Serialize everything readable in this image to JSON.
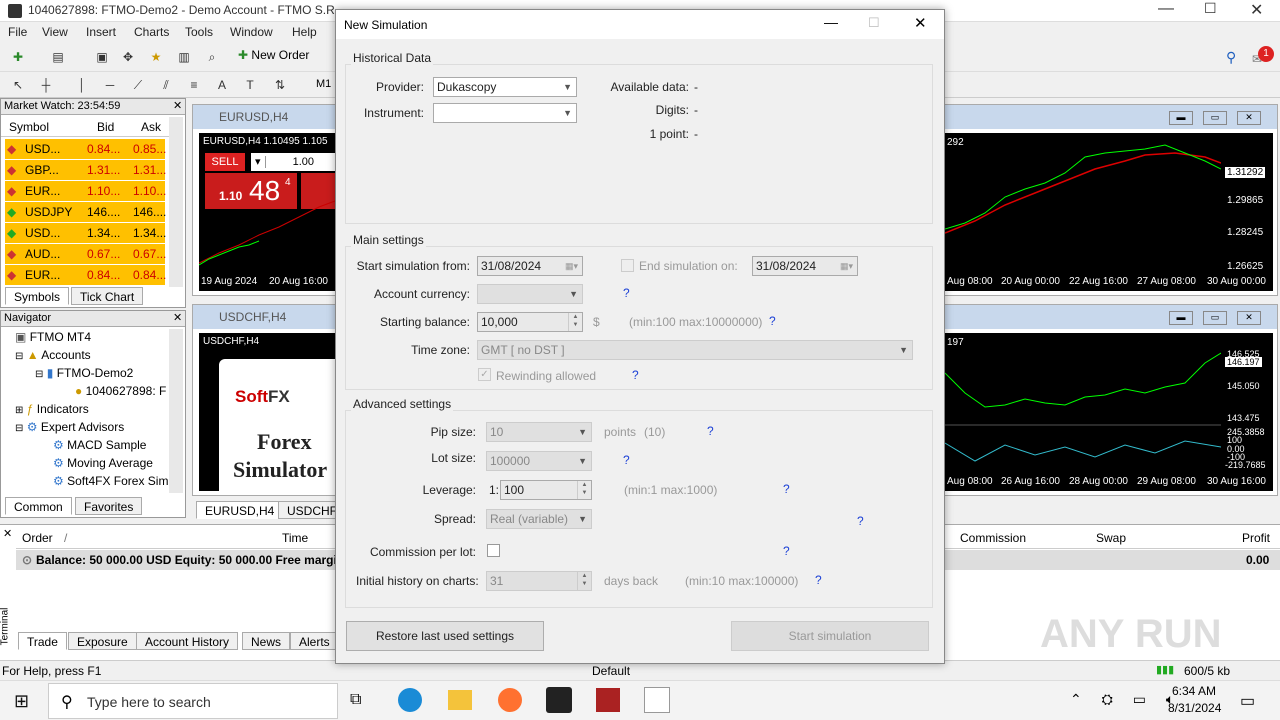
{
  "app": {
    "title": "1040627898: FTMO-Demo2 - Demo Account - FTMO S.R.O.",
    "menu": [
      "File",
      "View",
      "Insert",
      "Charts",
      "Tools",
      "Window",
      "Help"
    ],
    "new_order": "New Order",
    "m1": "M1",
    "notification_count": "1"
  },
  "market_watch": {
    "title": "Market Watch: 23:54:59",
    "headers": [
      "Symbol",
      "Bid",
      "Ask"
    ],
    "rows": [
      {
        "symbol": "USD...",
        "bid": "0.84...",
        "ask": "0.85..."
      },
      {
        "symbol": "GBP...",
        "bid": "1.31...",
        "ask": "1.31..."
      },
      {
        "symbol": "EUR...",
        "bid": "1.10...",
        "ask": "1.10..."
      },
      {
        "symbol": "USDJPY",
        "bid": "146....",
        "ask": "146...."
      },
      {
        "symbol": "USD...",
        "bid": "1.34...",
        "ask": "1.34..."
      },
      {
        "symbol": "AUD...",
        "bid": "0.67...",
        "ask": "0.67..."
      },
      {
        "symbol": "EUR...",
        "bid": "0.84...",
        "ask": "0.84..."
      }
    ],
    "tabs": [
      "Symbols",
      "Tick Chart"
    ]
  },
  "navigator": {
    "title": "Navigator",
    "items": [
      "FTMO MT4",
      "Accounts",
      "FTMO-Demo2",
      "1040627898: F",
      "Indicators",
      "Expert Advisors",
      "MACD Sample",
      "Moving Average",
      "Soft4FX Forex Sim"
    ],
    "tabs": [
      "Common",
      "Favorites"
    ]
  },
  "charts": {
    "eurusd": {
      "title": "EURUSD,H4",
      "info": "EURUSD,H4  1.10495 1.105",
      "sell": "SELL",
      "lot": "1.00",
      "price_big": "48",
      "price_prefix": "1.10",
      "price_sup": "4",
      "x_labels": [
        "19 Aug 2024",
        "20 Aug 16:00"
      ],
      "right_x_labels": [
        "Aug 08:00",
        "20 Aug 00:00",
        "22 Aug 16:00",
        "27 Aug 08:00",
        "30 Aug 00:00"
      ],
      "right_y_labels": [
        "1.31292",
        "1.29865",
        "1.28245",
        "1.26625"
      ],
      "top_label": "292"
    },
    "usdchf": {
      "title": "USDCHF,H4",
      "info": "USDCHF,H4",
      "brand": "Soft",
      "brand2": "FX",
      "product1": "Forex",
      "product2": "Simulator",
      "right_x_labels": [
        "Aug 08:00",
        "26 Aug 16:00",
        "28 Aug 00:00",
        "29 Aug 08:00",
        "30 Aug 16:00"
      ],
      "right_y_labels": [
        "146.525",
        "146.197",
        "145.050",
        "143.475",
        "245.3858",
        "100",
        "0.00",
        "-100",
        "-219.7685"
      ],
      "top_label": "197"
    },
    "tabs": [
      "EURUSD,H4",
      "USDCHF,"
    ]
  },
  "terminal": {
    "label": "Terminal",
    "headers": [
      "Order",
      "/",
      "Time",
      "Commission",
      "Swap",
      "Profit"
    ],
    "balance": "Balance: 50 000.00 USD  Equity: 50 000.00  Free margi",
    "profit": "0.00",
    "tabs": [
      "Trade",
      "Exposure",
      "Account History",
      "News",
      "Alerts"
    ]
  },
  "status": {
    "help": "For Help, press F1",
    "profile": "Default",
    "traffic": "600/5 kb"
  },
  "taskbar": {
    "search_placeholder": "Type here to search",
    "time": "6:34 AM",
    "date": "8/31/2024"
  },
  "watermark": "ANY RUN",
  "dialog": {
    "title": "New Simulation",
    "historical": {
      "group": "Historical Data",
      "provider_label": "Provider:",
      "provider_value": "Dukascopy",
      "instrument_label": "Instrument:",
      "instrument_value": "",
      "available_label": "Available data:",
      "available_value": "-",
      "digits_label": "Digits:",
      "digits_value": "-",
      "point_label": "1 point:",
      "point_value": "-"
    },
    "main": {
      "group": "Main settings",
      "start_label": "Start simulation from:",
      "start_value": "31/08/2024",
      "end_label": "End simulation on:",
      "end_value": "31/08/2024",
      "currency_label": "Account currency:",
      "currency_value": "",
      "balance_label": "Starting balance:",
      "balance_value": "10,000",
      "balance_unit": "$",
      "balance_range": "(min:100  max:10000000)",
      "timezone_label": "Time zone:",
      "timezone_value": "GMT [ no DST ]",
      "rewind_label": "Rewinding allowed"
    },
    "advanced": {
      "group": "Advanced settings",
      "pip_label": "Pip size:",
      "pip_value": "10",
      "pip_unit": "points",
      "pip_extra": "(10)",
      "lot_label": "Lot size:",
      "lot_value": "100000",
      "leverage_label": "Leverage:",
      "leverage_prefix": "1:",
      "leverage_value": "100",
      "leverage_range": "(min:1  max:1000)",
      "spread_label": "Spread:",
      "spread_value": "Real (variable)",
      "commission_label": "Commission per lot:",
      "history_label": "Initial history on charts:",
      "history_value": "31",
      "history_unit": "days back",
      "history_range": "(min:10  max:100000)"
    },
    "help": "?",
    "restore_button": "Restore last used settings",
    "start_button": "Start simulation"
  }
}
